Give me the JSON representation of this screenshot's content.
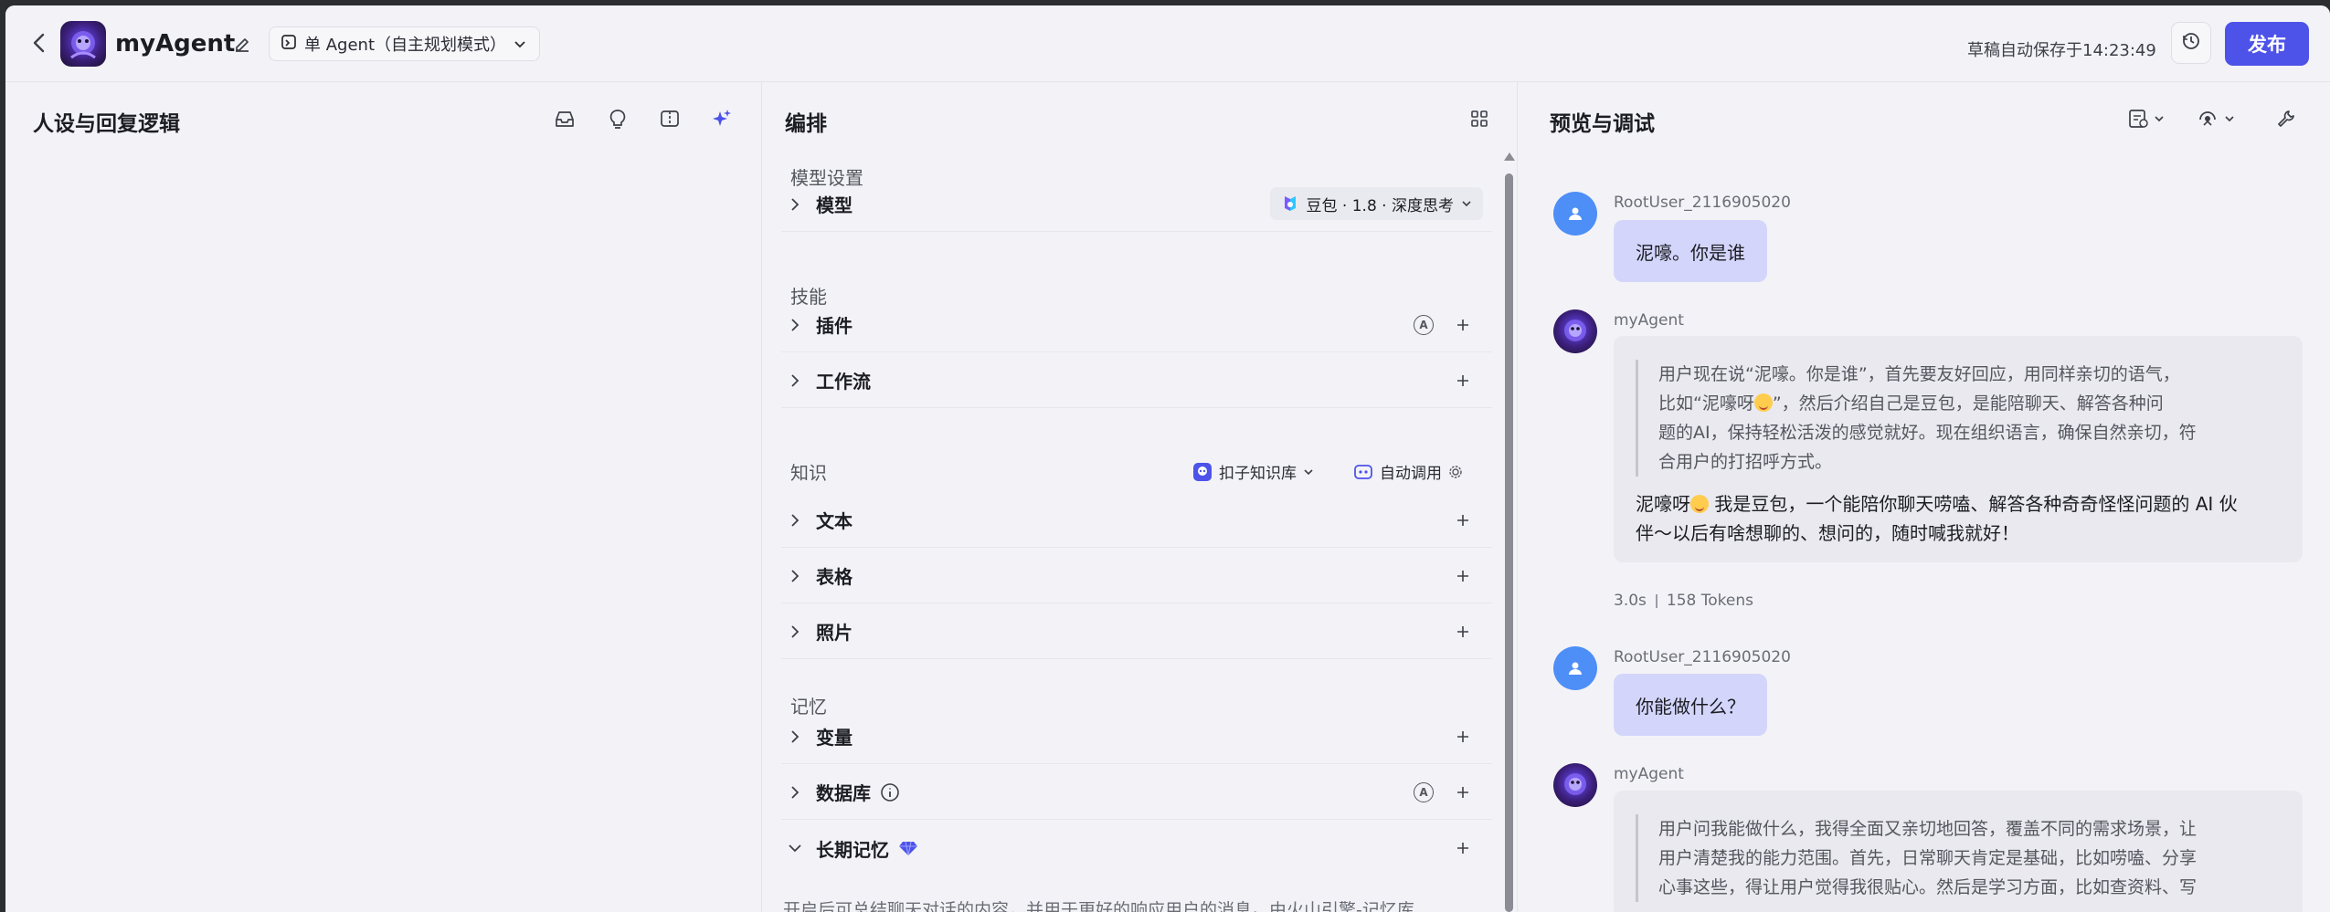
{
  "header": {
    "agent_name": "myAgent",
    "mode_label": "单 Agent（自主规划模式）",
    "save_status": "草稿自动保存于14:23:49",
    "publish_label": "发布"
  },
  "left_panel": {
    "title": "人设与回复逻辑"
  },
  "mid_panel": {
    "title": "编排",
    "model_section": "模型设置",
    "model_row": "模型",
    "model_value": "豆包 · 1.8 · 深度思考",
    "skills_section": "技能",
    "plugins_row": "插件",
    "workflow_row": "工作流",
    "knowledge_section": "知识",
    "kb_selector": "扣子知识库",
    "auto_call": "自动调用",
    "text_row": "文本",
    "table_row": "表格",
    "photo_row": "照片",
    "memory_section": "记忆",
    "variable_row": "变量",
    "database_row": "数据库",
    "long_memory_row": "长期记忆",
    "long_memory_desc": "开启后可总结聊天对话的内容，并用于更好的响应用户的消息。由火山引擎-记忆库"
  },
  "right_panel": {
    "title": "预览与调试",
    "messages": [
      {
        "sender": "RootUser_2116905020",
        "text": "泥嚎。你是谁"
      },
      {
        "sender": "myAgent",
        "reasoning": [
          "用户现在说“泥嚎。你是谁”，首先要友好回应，用同样亲切的语气，",
          "比如“泥嚎呀",
          "”，然后介绍自己是豆包，是能陪聊天、解答各种问",
          "题的AI，保持轻松活泼的感觉就好。现在组织语言，确保自然亲切，符",
          "合用户的打招呼方式。"
        ],
        "answer": [
          "泥嚎呀",
          " 我是豆包，一个能陪你聊天唠嗑、解答各种奇奇怪怪问题的 AI 伙",
          "伴～以后有啥想聊的、想问的，随时喊我就好！"
        ],
        "time": "3.0s",
        "tokens": "158 Tokens"
      },
      {
        "sender": "RootUser_2116905020",
        "text": "你能做什么？"
      },
      {
        "sender": "myAgent",
        "reasoning": [
          "用户问我能做什么，我得全面又亲切地回答，覆盖不同的需求场景，让",
          "用户清楚我的能力范围。首先，日常聊天肯定是基础，比如唠嗑、分享",
          "心事这些，得让用户觉得我很贴心。然后是学习方面，比如查资料、写"
        ]
      }
    ]
  },
  "icons": [
    "back-icon",
    "edit-icon",
    "mode-icon",
    "history-icon",
    "inbox-icon",
    "bulb-icon",
    "split-icon",
    "sparkle-icon",
    "grid-icon",
    "chat-export-icon",
    "debug-icon",
    "wrench-icon",
    "chevron-right-icon",
    "plus-icon",
    "diamond-icon",
    "info-icon",
    "user-icon"
  ],
  "colors": {
    "accent": "#4d53e8",
    "user_bubble": "#d3d5fb",
    "bot_bubble": "#e9e9ef",
    "user_avatar": "#4e8ef7"
  }
}
